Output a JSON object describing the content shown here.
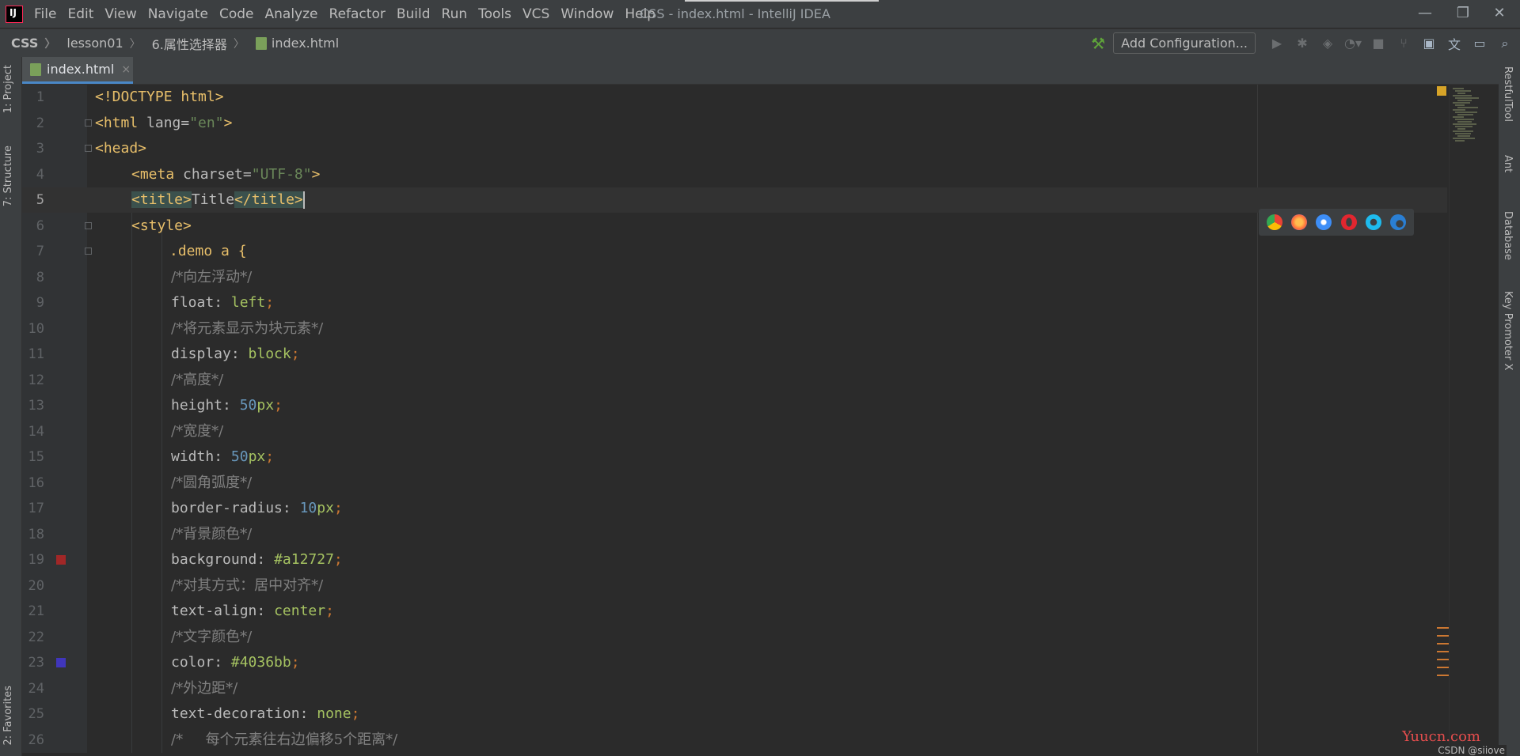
{
  "window": {
    "title": "CSS - index.html - IntelliJ IDEA",
    "app_logo_text": "IJ",
    "controls": {
      "minimize": "—",
      "maximize": "❐",
      "close": "✕"
    }
  },
  "menu": [
    "File",
    "Edit",
    "View",
    "Navigate",
    "Code",
    "Analyze",
    "Refactor",
    "Build",
    "Run",
    "Tools",
    "VCS",
    "Window",
    "Help"
  ],
  "breadcrumb": {
    "root": "CSS",
    "items": [
      "lesson01",
      "6.属性选择器",
      "index.html"
    ]
  },
  "toolbar": {
    "add_configuration": "Add Configuration..."
  },
  "tabs": [
    {
      "label": "index.html",
      "close": "×"
    }
  ],
  "left_tool_windows": [
    "1: Project",
    "7: Structure",
    "2: Favorites"
  ],
  "right_tool_windows": [
    "RestfulTool",
    "Ant",
    "Database",
    "Key Promoter X"
  ],
  "editor": {
    "current_line": 5,
    "lines": [
      {
        "n": "1"
      },
      {
        "n": "2"
      },
      {
        "n": "3"
      },
      {
        "n": "4"
      },
      {
        "n": "5"
      },
      {
        "n": "6"
      },
      {
        "n": "7"
      },
      {
        "n": "8",
        "comment": "/*向左浮动*/"
      },
      {
        "n": "9",
        "prop": "float",
        "value": "left"
      },
      {
        "n": "10",
        "comment": "/*将元素显示为块元素*/"
      },
      {
        "n": "11",
        "prop": "display",
        "value": "block"
      },
      {
        "n": "12",
        "comment": "/*高度*/"
      },
      {
        "n": "13",
        "prop": "height",
        "num": "50",
        "unit": "px"
      },
      {
        "n": "14",
        "comment": "/*宽度*/"
      },
      {
        "n": "15",
        "prop": "width",
        "num": "50",
        "unit": "px"
      },
      {
        "n": "16",
        "comment": "/*圆角弧度*/"
      },
      {
        "n": "17",
        "prop": "border-radius",
        "num": "10",
        "unit": "px"
      },
      {
        "n": "18",
        "comment": "/*背景颜色*/"
      },
      {
        "n": "19",
        "prop": "background",
        "value": "#a12727",
        "swatch": "#a12727"
      },
      {
        "n": "20",
        "comment": "/*对其方式：居中对齐*/"
      },
      {
        "n": "21",
        "prop": "text-align",
        "value": "center"
      },
      {
        "n": "22",
        "comment": "/*文字颜色*/"
      },
      {
        "n": "23",
        "prop": "color",
        "value": "#4036bb",
        "swatch": "#4036bb"
      },
      {
        "n": "24",
        "comment": "/*外边距*/"
      },
      {
        "n": "25",
        "prop": "text-decoration",
        "value": "none"
      },
      {
        "n": "26",
        "comment": "/*     每个元素往右边偏移5个距离*/"
      }
    ],
    "code": {
      "l1_doctype": "<!DOCTYPE html>",
      "l2_open": "<html",
      "l2_attr": " lang=",
      "l2_val": "\"en\"",
      "l2_close": ">",
      "l3": "<head>",
      "l4_open": "<meta",
      "l4_attr": " charset=",
      "l4_val": "\"UTF-8\"",
      "l4_close": ">",
      "l5_open": "<title>",
      "l5_text": "Title",
      "l5_close": "</title>",
      "l6": "<style>",
      "l7_sel": ".demo a",
      "l7_brace": " {"
    }
  },
  "browsers": [
    "chrome-icon",
    "firefox-icon",
    "safari-icon",
    "opera-icon",
    "ie-icon",
    "edge-icon"
  ],
  "colors": {
    "browser_chrome": "#e94235",
    "browser_firefox": "#ff7139",
    "browser_safari": "#3d8ef7",
    "browser_opera": "#e2262f",
    "browser_ie": "#1ebbee",
    "browser_edge": "#2a7fd4"
  },
  "watermark": "Yuucn.com",
  "footer_credit": "CSDN @siiove"
}
